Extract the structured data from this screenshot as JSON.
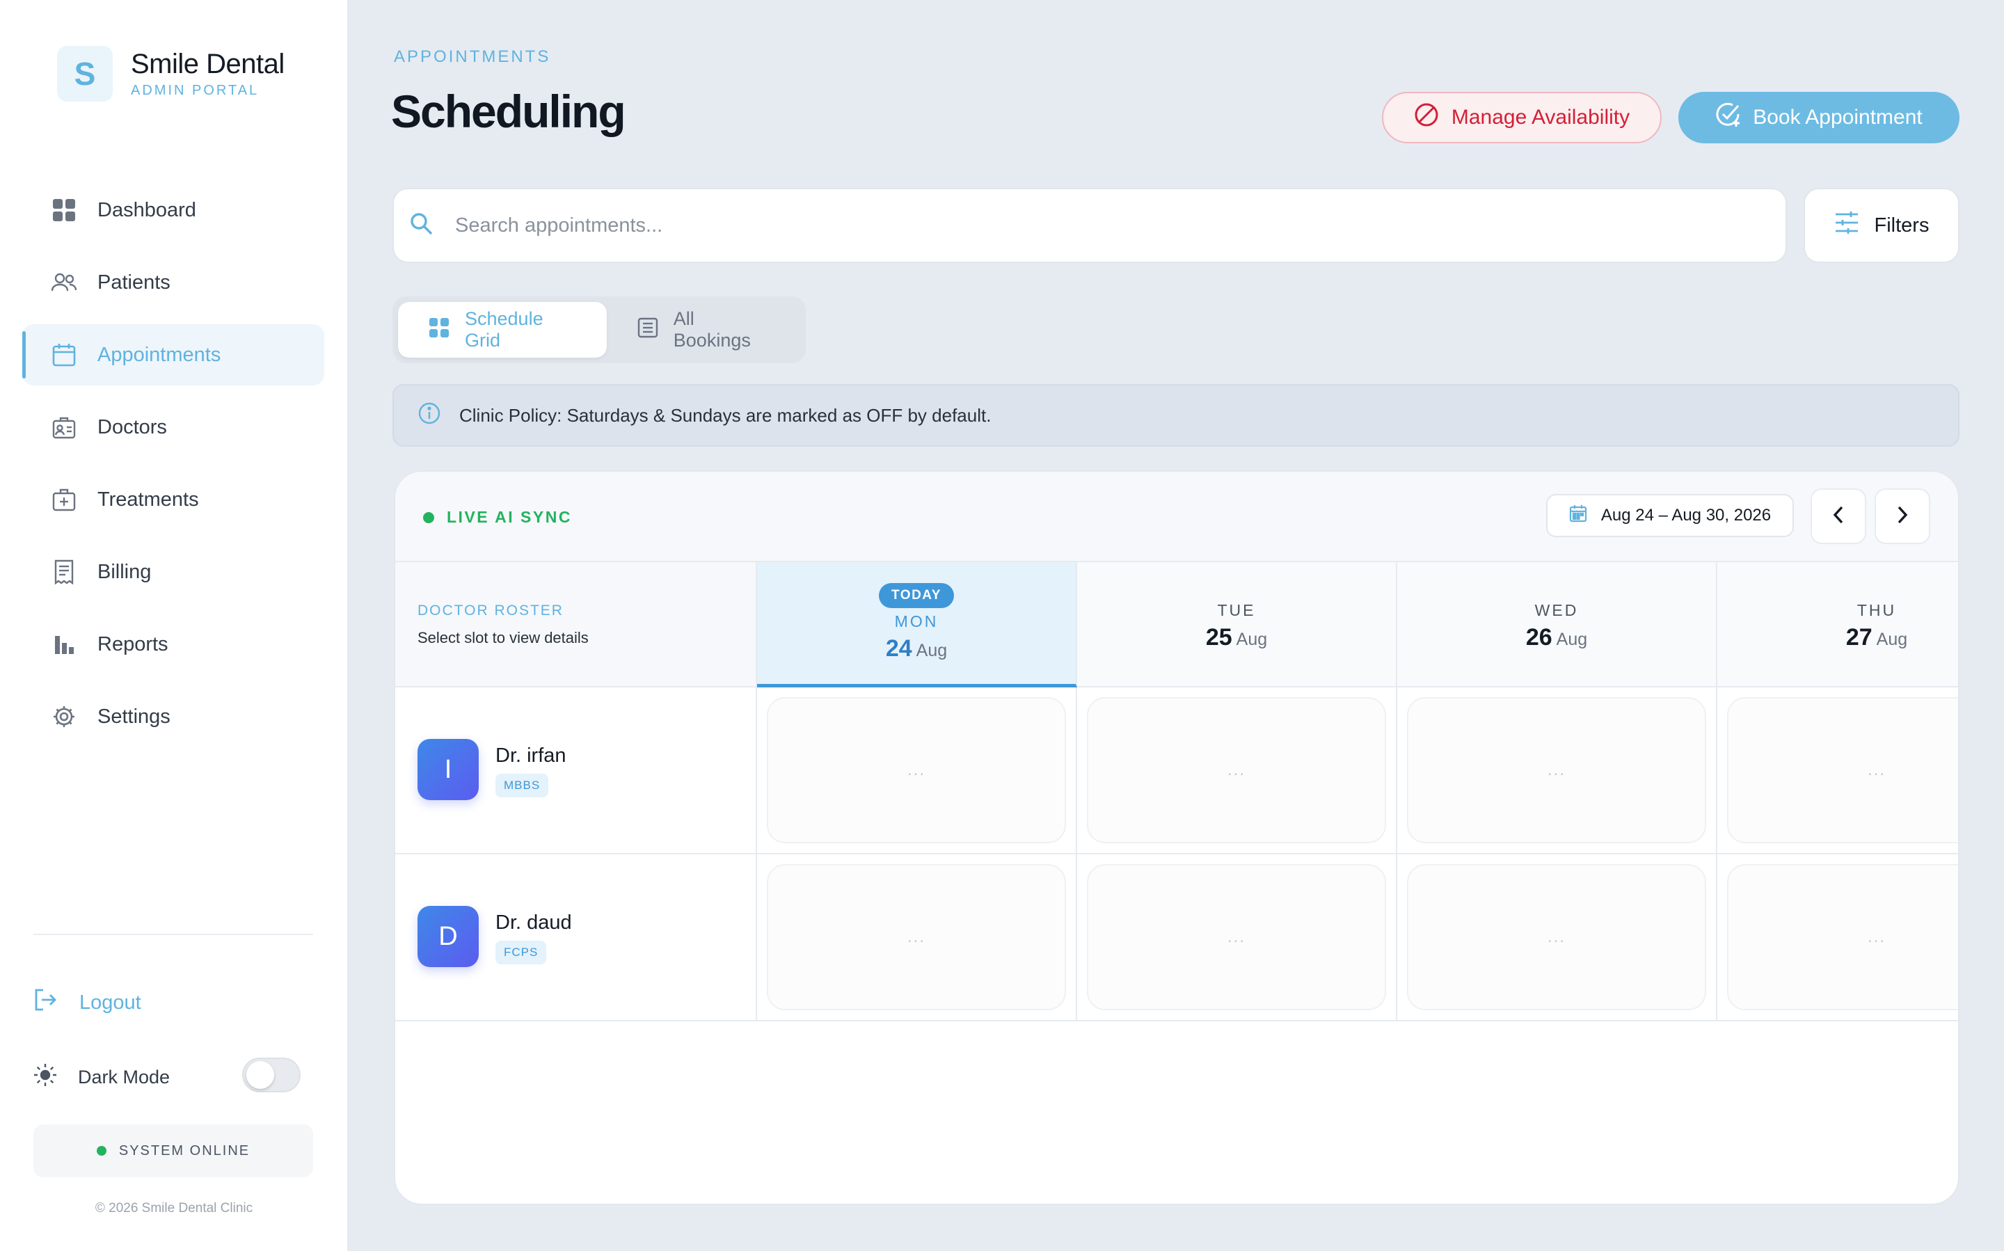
{
  "brand": {
    "logo_letter": "S",
    "name": "Smile Dental",
    "subtitle": "ADMIN PORTAL"
  },
  "sidebar": {
    "items": [
      {
        "label": "Dashboard",
        "icon": "grid-icon",
        "active": false
      },
      {
        "label": "Patients",
        "icon": "users-icon",
        "active": false
      },
      {
        "label": "Appointments",
        "icon": "calendar-icon",
        "active": true
      },
      {
        "label": "Doctors",
        "icon": "doctor-badge-icon",
        "active": false
      },
      {
        "label": "Treatments",
        "icon": "medical-kit-icon",
        "active": false
      },
      {
        "label": "Billing",
        "icon": "receipt-icon",
        "active": false
      },
      {
        "label": "Reports",
        "icon": "bar-chart-icon",
        "active": false
      },
      {
        "label": "Settings",
        "icon": "gear-icon",
        "active": false
      }
    ],
    "logout_label": "Logout",
    "dark_mode_label": "Dark Mode",
    "dark_mode_on": false,
    "system_status": "SYSTEM ONLINE",
    "copyright": "© 2026 Smile Dental Clinic"
  },
  "header": {
    "eyebrow": "APPOINTMENTS",
    "title": "Scheduling",
    "manage_label": "Manage Availability",
    "book_label": "Book Appointment"
  },
  "search": {
    "placeholder": "Search appointments...",
    "value": "",
    "filters_label": "Filters"
  },
  "tabs": [
    {
      "label": "Schedule Grid",
      "active": true
    },
    {
      "label": "All Bookings",
      "active": false
    }
  ],
  "policy": {
    "text": "Clinic Policy: Saturdays & Sundays are marked as OFF by default."
  },
  "calendar": {
    "live_label": "LIVE AI SYNC",
    "date_range": "Aug 24 – Aug 30, 2026",
    "roster_title": "DOCTOR ROSTER",
    "roster_subtitle": "Select slot to view details",
    "today_badge": "TODAY",
    "days": [
      {
        "name": "MON",
        "num": "24",
        "month": "Aug",
        "today": true
      },
      {
        "name": "TUE",
        "num": "25",
        "month": "Aug",
        "today": false
      },
      {
        "name": "WED",
        "num": "26",
        "month": "Aug",
        "today": false
      },
      {
        "name": "THU",
        "num": "27",
        "month": "Aug",
        "today": false
      }
    ],
    "doctors": [
      {
        "initial": "I",
        "name": "Dr. irfan",
        "qualification": "MBBS"
      },
      {
        "initial": "D",
        "name": "Dr. daud",
        "qualification": "FCPS"
      }
    ],
    "slot_placeholder": "..."
  },
  "colors": {
    "accent": "#5fb3df",
    "danger": "#d41f35",
    "today": "#3e97d9",
    "online": "#22b35e"
  }
}
